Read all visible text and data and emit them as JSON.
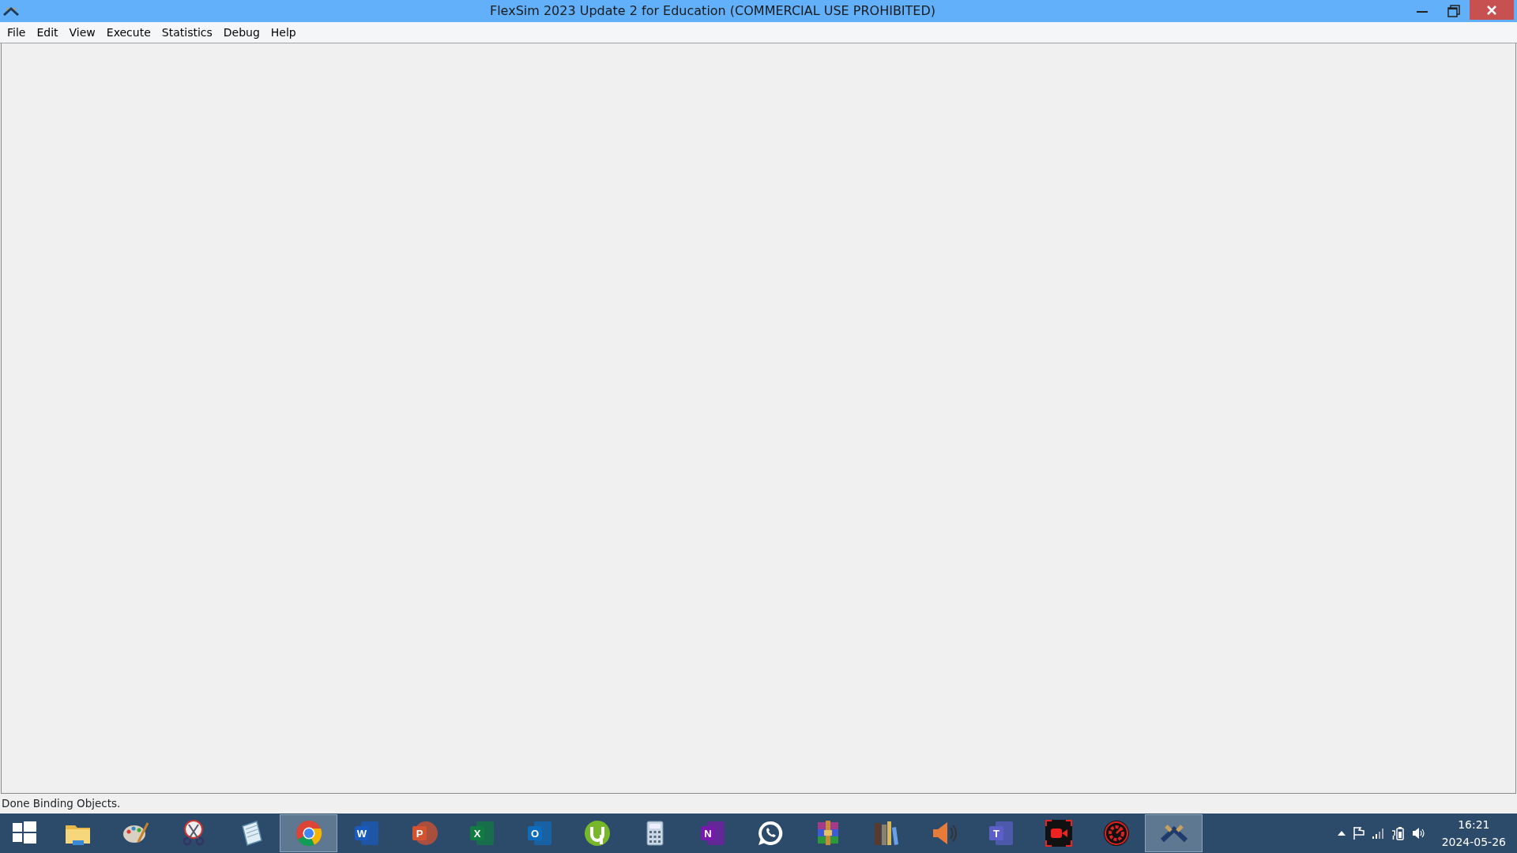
{
  "window": {
    "title": "FlexSim 2023 Update 2 for Education (COMMERCIAL USE PROHIBITED)"
  },
  "menu": [
    "File",
    "Edit",
    "View",
    "Execute",
    "Statistics",
    "Debug",
    "Help"
  ],
  "status_bar": "Done Binding Objects.",
  "taskbar": {
    "apps": [
      {
        "kind": "start",
        "selected": false
      },
      {
        "kind": "folder",
        "selected": false
      },
      {
        "kind": "palette",
        "selected": false
      },
      {
        "kind": "scissors",
        "selected": false
      },
      {
        "kind": "notepad",
        "selected": false
      },
      {
        "kind": "browser",
        "selected": true
      },
      {
        "kind": "letter",
        "letter": "W",
        "color": "#185abd",
        "selected": false
      },
      {
        "kind": "round-letter",
        "letter": "P",
        "color": "#d35230",
        "selected": false
      },
      {
        "kind": "letter",
        "letter": "X",
        "color": "#107c41",
        "selected": false
      },
      {
        "kind": "letter",
        "letter": "O",
        "color": "#0f6cbd",
        "selected": false
      },
      {
        "kind": "torrent",
        "selected": false
      },
      {
        "kind": "calculator",
        "selected": false
      },
      {
        "kind": "letter",
        "letter": "N",
        "color": "#7719aa",
        "selected": false
      },
      {
        "kind": "chat",
        "selected": false
      },
      {
        "kind": "archive",
        "selected": false
      },
      {
        "kind": "books",
        "selected": false
      },
      {
        "kind": "speaker",
        "selected": false
      },
      {
        "kind": "letter",
        "letter": "T",
        "color": "#5b5fc7",
        "selected": false
      },
      {
        "kind": "camera",
        "selected": false
      },
      {
        "kind": "gear",
        "selected": false
      },
      {
        "kind": "logo",
        "selected": true
      }
    ],
    "tray": {
      "time": "16:21",
      "date": "2024-05-26"
    }
  }
}
